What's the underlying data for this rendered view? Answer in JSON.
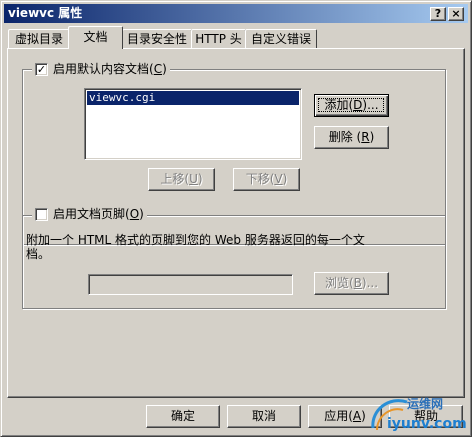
{
  "window": {
    "title": "viewvc 属性",
    "help_btn": "?",
    "close_btn": "×"
  },
  "tabs": [
    {
      "label": "虚拟目录",
      "active": false
    },
    {
      "label": "文档",
      "active": true
    },
    {
      "label": "目录安全性",
      "active": false
    },
    {
      "label": "HTTP 头",
      "active": false
    },
    {
      "label": "自定义错误",
      "active": false
    }
  ],
  "default_doc": {
    "check_mark": "✓",
    "label_prefix": "启用默认内容文档(",
    "label_key": "C",
    "label_suffix": ")",
    "checked": true,
    "list_items": [
      "viewvc.cgi"
    ],
    "add_prefix": "添加(",
    "add_key": "D",
    "add_suffix": ")...",
    "remove_prefix": "删除 (",
    "remove_key": "R",
    "remove_suffix": ")",
    "up_prefix": "上移(",
    "up_key": "U",
    "up_suffix": ")",
    "down_prefix": "下移(",
    "down_key": "V",
    "down_suffix": ")"
  },
  "footer_doc": {
    "label_prefix": "启用文档页脚(",
    "label_key": "O",
    "label_suffix": ")",
    "checked": false,
    "description_line1": "附加一个 HTML 格式的页脚到您的 Web 服务器返回的每一个文",
    "description_line2": "档。",
    "path_value": "",
    "browse_prefix": "浏览(",
    "browse_key": "B",
    "browse_suffix": ")..."
  },
  "footer_buttons": {
    "ok": "确定",
    "cancel": "取消",
    "apply_prefix": "应用(",
    "apply_key": "A",
    "apply_suffix": ")",
    "help": "帮助"
  },
  "watermark": {
    "text1": "运维网",
    "text2": "iyunv.com"
  },
  "colors": {
    "face": "#d4d0c8",
    "title_start": "#0a246a",
    "title_end": "#a6caf0",
    "selection": "#0a246a"
  }
}
